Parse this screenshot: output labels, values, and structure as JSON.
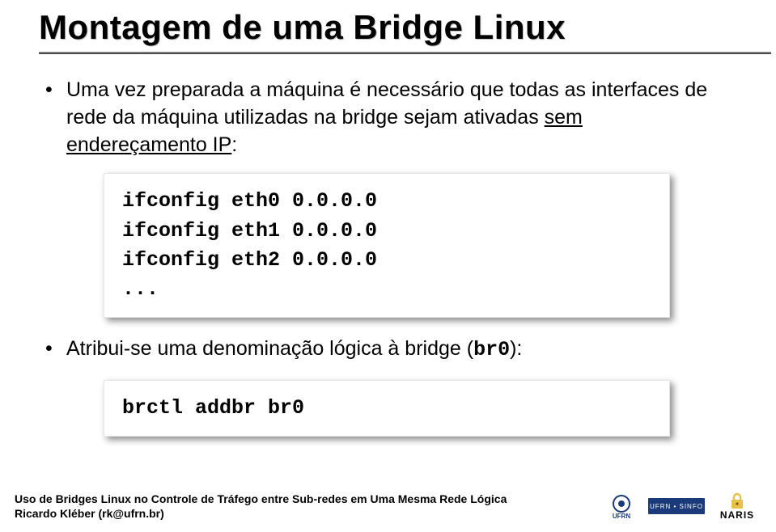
{
  "title": "Montagem de uma Bridge Linux",
  "bullets": [
    {
      "pre": "Uma vez preparada a máquina é necessário que todas as interfaces de rede da máquina utilizadas na bridge sejam ativadas ",
      "u1": "sem endereçamento IP",
      "post": ":"
    },
    {
      "pre": "Atribui-se uma denominação lógica à bridge (",
      "mono": "br0",
      "post": "):"
    }
  ],
  "code1": {
    "lines": [
      "ifconfig eth0 0.0.0.0",
      "ifconfig eth1 0.0.0.0",
      "ifconfig eth2 0.0.0.0",
      "..."
    ]
  },
  "code2": {
    "lines": [
      "brctl addbr br0"
    ]
  },
  "footer": {
    "line1": "Uso de Bridges Linux no Controle de Tráfego entre Sub-redes em Uma Mesma Rede Lógica",
    "line2": "Ricardo Kléber (rk@ufrn.br)"
  },
  "logos": {
    "ufrn": "UFRN",
    "sinfo": "UFRN • SINFO",
    "naris": "NARIS"
  }
}
